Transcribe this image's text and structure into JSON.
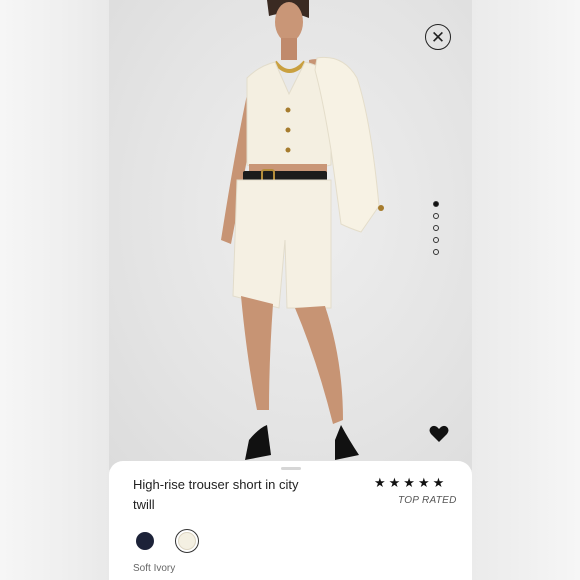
{
  "product": {
    "title": "High-rise trouser short in city twill",
    "stars": "★★★★★",
    "rating_badge": "TOP RATED",
    "selected_color": "Soft Ivory",
    "colors": [
      {
        "hex": "#1c2238"
      },
      {
        "hex": "#f4f0e2"
      }
    ]
  },
  "gallery": {
    "total_images": 5,
    "active_index": 0
  },
  "icons": {
    "close": "close-icon",
    "favorite": "heart-icon"
  }
}
